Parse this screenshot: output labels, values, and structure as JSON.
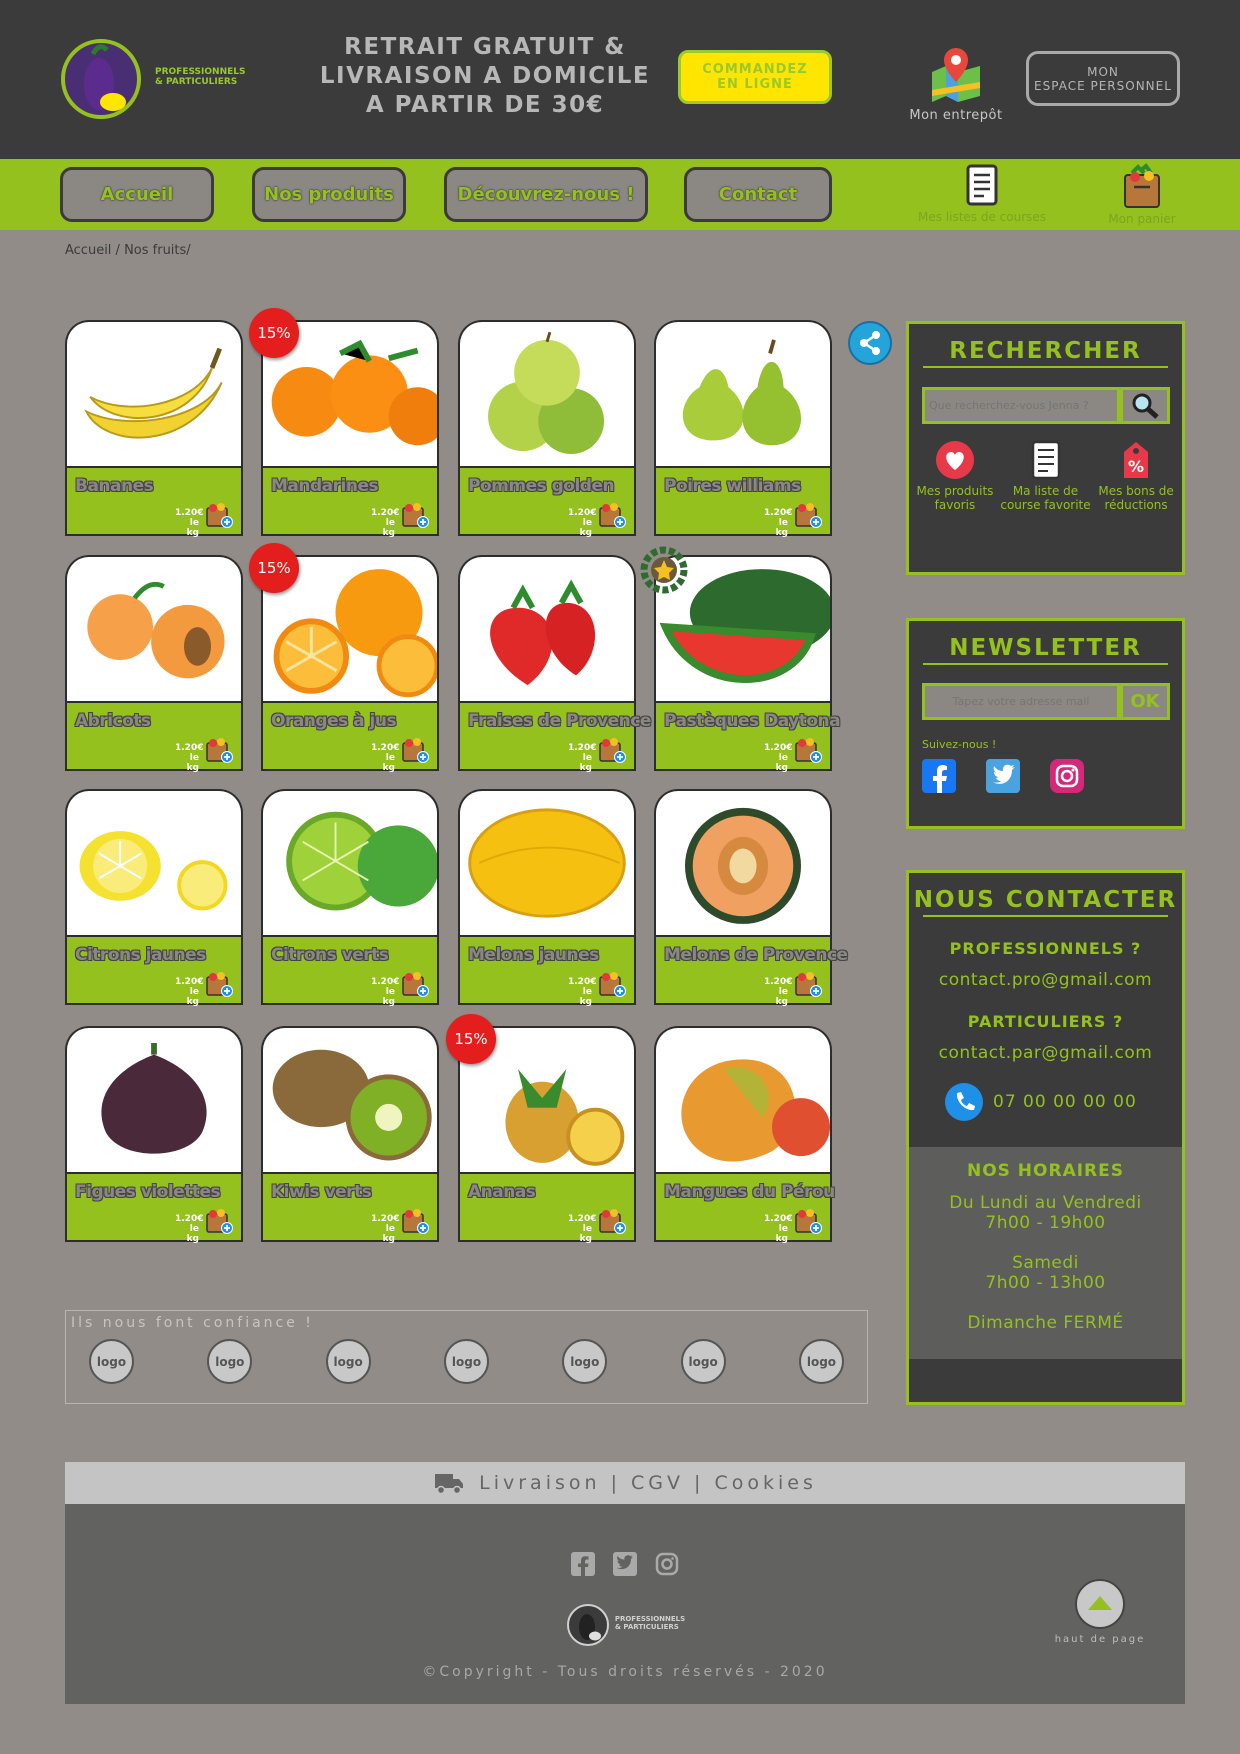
{
  "header": {
    "brand_line1": "PROFESSIONNELS",
    "brand_line2": "& PARTICULIERS",
    "headline_l1": "RETRAIT GRATUIT &",
    "headline_l2": "LIVRAISON A DOMICILE",
    "headline_l3": "A PARTIR DE 30€",
    "order_l1": "COMMANDEZ",
    "order_l2": "EN LIGNE",
    "warehouse_label": "Mon entrepôt",
    "account_l1": "MON",
    "account_l2": "ESPACE PERSONNEL"
  },
  "nav": {
    "items": [
      "Accueil",
      "Nos produits",
      "Découvrez-nous !",
      "Contact"
    ],
    "shopping_lists": "Mes listes de courses",
    "cart": "Mon panier"
  },
  "breadcrumb": "Accueil / Nos fruits/",
  "products": [
    {
      "name": "Bananes",
      "price": "1.20€",
      "unit": "le kg",
      "discount": "",
      "icon": "banana"
    },
    {
      "name": "Mandarines",
      "price": "1.20€",
      "unit": "le kg",
      "discount": "15%",
      "icon": "mandarin"
    },
    {
      "name": "Pommes golden",
      "price": "1.20€",
      "unit": "le kg",
      "discount": "",
      "icon": "apple"
    },
    {
      "name": "Poires williams",
      "price": "1.20€",
      "unit": "le kg",
      "discount": "",
      "icon": "pear"
    },
    {
      "name": "Abricots",
      "price": "1.20€",
      "unit": "le kg",
      "discount": "",
      "icon": "apricot"
    },
    {
      "name": "Oranges à jus",
      "price": "1.20€",
      "unit": "le kg",
      "discount": "15%",
      "icon": "orange"
    },
    {
      "name": "Fraises de Provence",
      "price": "1.20€",
      "unit": "le kg",
      "discount": "",
      "icon": "strawberry"
    },
    {
      "name": "Pastèques Daytona",
      "price": "1.20€",
      "unit": "le kg",
      "discount": "",
      "icon": "watermelon"
    },
    {
      "name": "Citrons jaunes",
      "price": "1.20€",
      "unit": "le kg",
      "discount": "",
      "icon": "lemon"
    },
    {
      "name": "Citrons verts",
      "price": "1.20€",
      "unit": "le kg",
      "discount": "",
      "icon": "lime"
    },
    {
      "name": "Melons jaunes",
      "price": "1.20€",
      "unit": "le kg",
      "discount": "",
      "icon": "yellow-melon"
    },
    {
      "name": "Melons de Provence",
      "price": "1.20€",
      "unit": "le kg",
      "discount": "",
      "icon": "cantaloupe"
    },
    {
      "name": "Figues violettes",
      "price": "1.20€",
      "unit": "le kg",
      "discount": "",
      "icon": "fig"
    },
    {
      "name": "Kiwis verts",
      "price": "1.20€",
      "unit": "le kg",
      "discount": "",
      "icon": "kiwi"
    },
    {
      "name": "Ananas",
      "price": "1.20€",
      "unit": "le kg",
      "discount": "15%",
      "icon": "pineapple"
    },
    {
      "name": "Mangues du Pérou",
      "price": "1.20€",
      "unit": "le kg",
      "discount": "",
      "icon": "mango"
    }
  ],
  "search": {
    "title": "RECHERCHER",
    "placeholder": "Que recherchez-vous Jenna ?",
    "shortcuts": [
      {
        "label": "Mes produits favoris",
        "icon": "heart-icon"
      },
      {
        "label": "Ma liste de course favorite",
        "icon": "list-icon"
      },
      {
        "label": "Mes bons de réductions",
        "icon": "coupon-icon"
      }
    ]
  },
  "newsletter": {
    "title": "NEWSLETTER",
    "placeholder": "Tapez votre adresse mail",
    "ok": "OK",
    "follow": "Suivez-nous !"
  },
  "contact": {
    "title": "NOUS CONTACTER",
    "pro_label": "PROFESSIONNELS ?",
    "pro_email": "contact.pro@gmail.com",
    "par_label": "PARTICULIERS ?",
    "par_email": "contact.par@gmail.com",
    "phone": "07 00 00 00 00",
    "hours_title": "NOS HORAIRES",
    "hours_week_l1": "Du Lundi au Vendredi",
    "hours_week_l2": "7h00 - 19h00",
    "hours_sat_l1": "Samedi",
    "hours_sat_l2": "7h00 - 13h00",
    "hours_sun": "Dimanche FERMÉ"
  },
  "trust": {
    "title": "Ils nous font confiance !",
    "logos": [
      "logo",
      "logo",
      "logo",
      "logo",
      "logo",
      "logo",
      "logo"
    ]
  },
  "footer": {
    "links": "Livraison | CGV | Cookies",
    "back_top": "haut de page",
    "brand_line1": "PROFESSIONNELS",
    "brand_line2": "& PARTICULIERS",
    "copyright": "©Copyright - Tous droits réservés - 2020"
  },
  "colors": {
    "accent": "#95c11f",
    "header_bg": "#3b3b3b",
    "page_bg": "#918c87",
    "badge": "#e41d1d",
    "cta": "#ffe500"
  }
}
